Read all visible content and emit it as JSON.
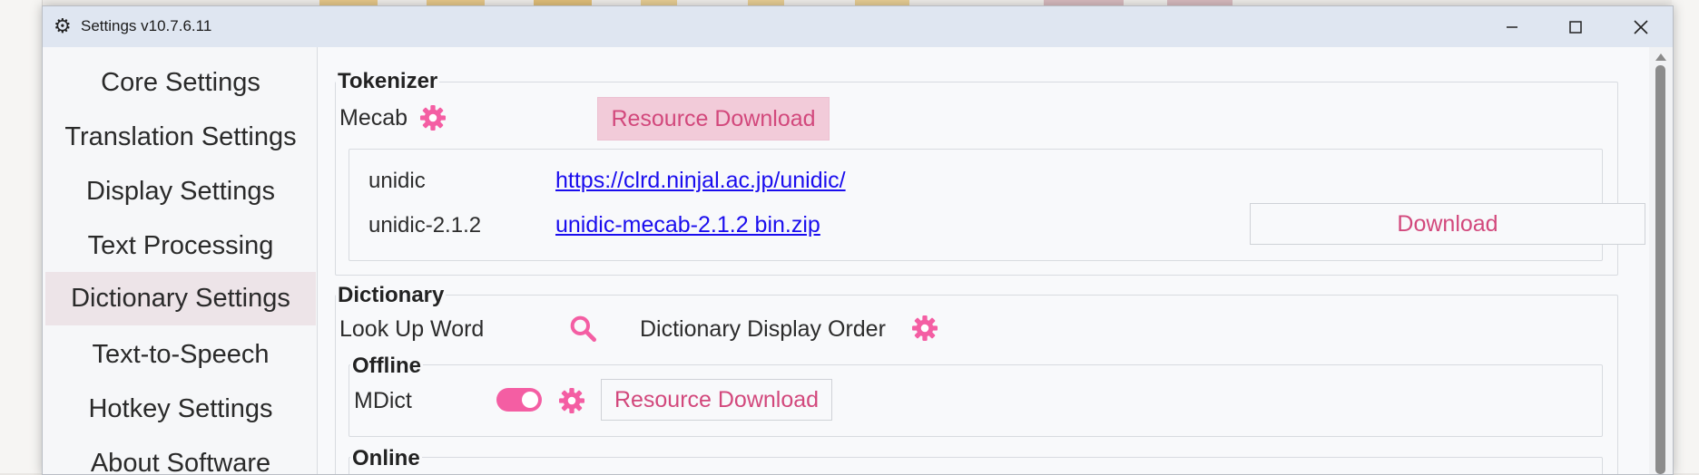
{
  "window": {
    "title": "Settings v10.7.6.11",
    "icons": {
      "app": "gear-icon",
      "minimize": "minimize-icon",
      "maximize": "maximize-icon",
      "close": "close-icon"
    }
  },
  "sidebar": {
    "items": [
      {
        "label": "Core Settings",
        "active": false
      },
      {
        "label": "Translation Settings",
        "active": false
      },
      {
        "label": "Display Settings",
        "active": false
      },
      {
        "label": "Text Processing",
        "active": false
      },
      {
        "label": "Dictionary Settings",
        "active": true
      },
      {
        "label": "Text-to-Speech",
        "active": false
      },
      {
        "label": "Hotkey Settings",
        "active": false
      },
      {
        "label": "About Software",
        "active": false
      }
    ]
  },
  "tokenizer": {
    "title": "Tokenizer",
    "engine_label": "Mecab",
    "resource_download": "Resource Download",
    "rows": [
      {
        "name": "unidic",
        "link": "https://clrd.ninjal.ac.jp/unidic/"
      },
      {
        "name": "unidic-2.1.2",
        "link": "unidic-mecab-2.1.2 bin.zip"
      }
    ],
    "download_button": "Download"
  },
  "dictionary": {
    "title": "Dictionary",
    "look_up_label": "Look Up Word",
    "display_order_label": "Dictionary Display Order",
    "offline": {
      "title": "Offline",
      "mdict_label": "MDict",
      "mdict_enabled": true,
      "resource_download": "Resource Download"
    },
    "online": {
      "title": "Online"
    }
  },
  "colors": {
    "accent": "#f45ea3",
    "accent_text": "#d2487c",
    "link": "#1a0dee",
    "active_item": "#ede4e8"
  }
}
